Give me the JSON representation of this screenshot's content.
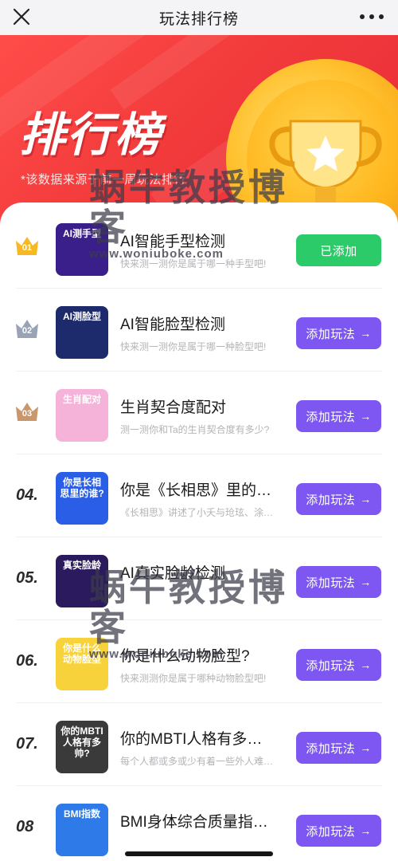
{
  "nav": {
    "title": "玩法排行榜",
    "close_icon": "close-icon",
    "more_icon": "more-dots-icon"
  },
  "banner": {
    "title": "排行榜",
    "subtitle": "*该数据来源于前一周玩法排行",
    "accent_color": "#f23b3b",
    "coin_color": "#ffc12e"
  },
  "watermark": {
    "text": "蜗牛教授博客",
    "url": "www.woniubоke.com"
  },
  "colors": {
    "add_button": "#7e57f2",
    "added_button": "#2ccb6a"
  },
  "items": [
    {
      "rank": "01",
      "title": "AI智能手型检测",
      "desc": "快来测一测你是属于哪一种手型吧!",
      "button": "已添加",
      "added": true,
      "thumb_text": "AI测手型",
      "thumb_color": "#3a1f8a"
    },
    {
      "rank": "02",
      "title": "AI智能脸型检测",
      "desc": "快来测一测你是属于哪一种脸型吧!",
      "button": "添加玩法",
      "added": false,
      "thumb_text": "AI测脸型",
      "thumb_color": "#1d2a6b"
    },
    {
      "rank": "03",
      "title": "生肖契合度配对",
      "desc": "测一测你和Ta的生肖契合度有多少?",
      "button": "添加玩法",
      "added": false,
      "thumb_text": "生肖配对",
      "thumb_color": "#f5b3d9"
    },
    {
      "rank": "04.",
      "title": "你是《长相思》里的…",
      "desc": "《长相思》讲述了小夭与玱玹、涂…",
      "button": "添加玩法",
      "added": false,
      "thumb_text": "你是长相思里的谁?",
      "thumb_color": "#2a5ee6"
    },
    {
      "rank": "05.",
      "title": "AI真实脸龄检测",
      "desc": "",
      "button": "添加玩法",
      "added": false,
      "thumb_text": "真实脸龄",
      "thumb_color": "#2b1a5e"
    },
    {
      "rank": "06.",
      "title": "你是什么动物脸型?",
      "desc": "快来测测你是属于哪种动物脸型吧!",
      "button": "添加玩法",
      "added": false,
      "thumb_text": "你是什么动物脸型",
      "thumb_color": "#f7d23a"
    },
    {
      "rank": "07.",
      "title": "你的MBTI人格有多…",
      "desc": "每个人都或多或少有着一些外人难…",
      "button": "添加玩法",
      "added": false,
      "thumb_text": "你的MBTI人格有多帅?",
      "thumb_color": "#3a3a3a"
    },
    {
      "rank": "08",
      "title": "BMI身体综合质量指…",
      "desc": "",
      "button": "添加玩法",
      "added": false,
      "thumb_text": "BMI指数",
      "thumb_color": "#2d7ae8"
    }
  ]
}
